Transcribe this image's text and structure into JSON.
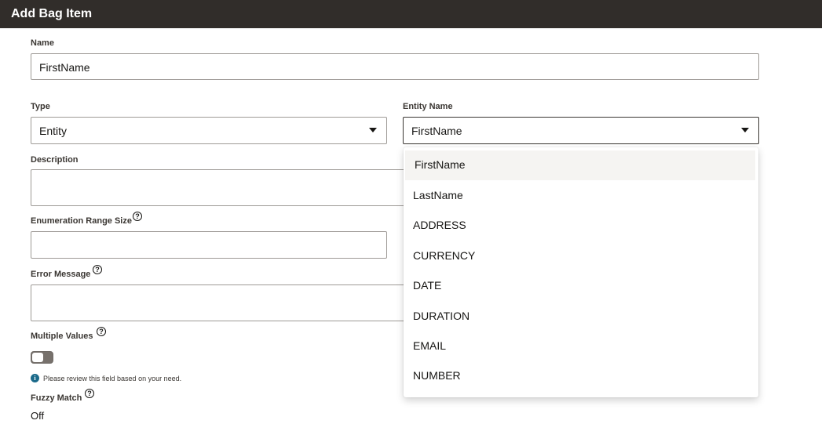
{
  "title": "Add Bag Item",
  "name": {
    "label": "Name",
    "value": "FirstName"
  },
  "type": {
    "label": "Type",
    "value": "Entity"
  },
  "entity_name": {
    "label": "Entity Name",
    "value": "FirstName",
    "options": [
      "FirstName",
      "LastName",
      "ADDRESS",
      "CURRENCY",
      "DATE",
      "DURATION",
      "EMAIL",
      "NUMBER"
    ]
  },
  "description": {
    "label": "Description",
    "value": ""
  },
  "enumeration_range_size": {
    "label": "Enumeration Range Size",
    "value": "",
    "help_icon": "question-circle-icon"
  },
  "error_message": {
    "label": "Error Message",
    "value": "",
    "help_icon": "question-circle-icon"
  },
  "multiple_values": {
    "label": "Multiple Values",
    "help_icon": "question-circle-icon",
    "checked": false,
    "hint": "Please review this field based on your need.",
    "hint_icon": "info-icon"
  },
  "fuzzy_match": {
    "label": "Fuzzy Match",
    "value": "Off",
    "help_icon": "question-circle-icon"
  },
  "colors": {
    "header_bg": "#312d2a",
    "focus_border": "#3a3632",
    "info": "#1b6a8a"
  }
}
